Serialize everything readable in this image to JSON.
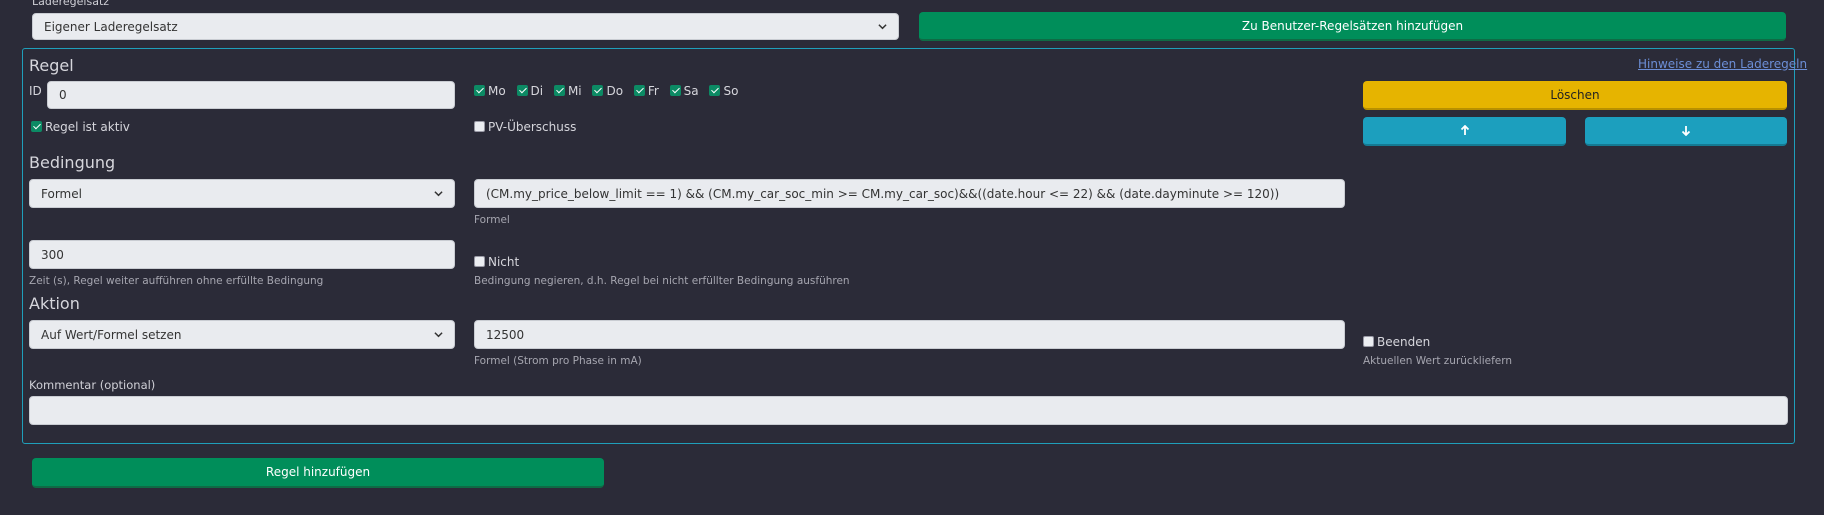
{
  "ruleset": {
    "label": "Laderegelsatz",
    "selected": "Eigener Laderegelsatz",
    "add_button": "Zu Benutzer-Regelsätzen hinzufügen"
  },
  "rule": {
    "title": "Regel",
    "hints_link": "Hinweise zu den Laderegeln",
    "id_label": "ID",
    "id_value": "0",
    "days": [
      {
        "label": "Mo",
        "checked": true
      },
      {
        "label": "Di",
        "checked": true
      },
      {
        "label": "Mi",
        "checked": true
      },
      {
        "label": "Do",
        "checked": true
      },
      {
        "label": "Fr",
        "checked": true
      },
      {
        "label": "Sa",
        "checked": true
      },
      {
        "label": "So",
        "checked": true
      }
    ],
    "active_label": "Regel ist aktiv",
    "pv_label": "PV-Überschuss",
    "delete_button": "Löschen"
  },
  "condition": {
    "title": "Bedingung",
    "type_selected": "Formel",
    "formula_value": "(CM.my_price_below_limit == 1) && (CM.my_car_soc_min >= CM.my_car_soc)&&((date.hour <= 22) && (date.dayminute >= 120))",
    "formula_help": "Formel",
    "time_value": "300",
    "time_help": "Zeit (s), Regel weiter aufführen ohne erfüllte Bedingung",
    "not_label": "Nicht",
    "not_help": "Bedingung negieren, d.h. Regel bei nicht erfüllter Bedingung ausführen"
  },
  "action": {
    "title": "Aktion",
    "type_selected": "Auf Wert/Formel setzen",
    "value": "12500",
    "value_help": "Formel (Strom pro Phase in mA)",
    "end_label": "Beenden",
    "end_help": "Aktuellen Wert zurückliefern"
  },
  "comment": {
    "label": "Kommentar (optional)",
    "value": ""
  },
  "add_rule_button": "Regel hinzufügen",
  "colors": {
    "background": "#2b2b38",
    "accent_border": "#1f9fba",
    "green": "#008e5a",
    "yellow": "#e6b400",
    "teal": "#1c9fbe"
  }
}
